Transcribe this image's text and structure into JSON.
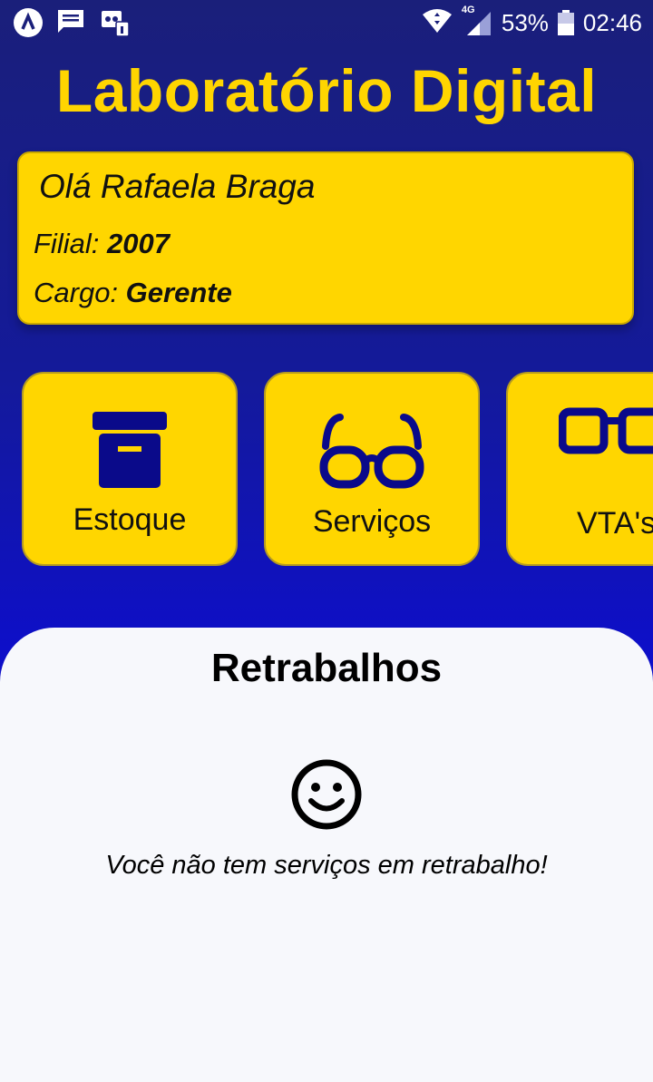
{
  "status_bar": {
    "battery_percent": "53%",
    "time": "02:46",
    "network": "4G",
    "icons": [
      "app-icon",
      "message-icon",
      "notification-icon",
      "wifi-icon",
      "signal-icon",
      "battery-icon"
    ]
  },
  "header": {
    "title": "Laboratório Digital"
  },
  "user_card": {
    "greeting": "Olá Rafaela Braga",
    "branch_label": "Filial:",
    "branch_value": "2007",
    "role_label": "Cargo:",
    "role_value": "Gerente"
  },
  "tiles": [
    {
      "label": "Estoque",
      "icon": "box-icon"
    },
    {
      "label": "Serviços",
      "icon": "glasses-icon"
    },
    {
      "label": "VTA's",
      "icon": "glasses-icon"
    }
  ],
  "panel": {
    "title": "Retrabalhos",
    "empty_message": "Você não tem serviços em retrabalho!",
    "empty_icon": "smiley-icon"
  },
  "colors": {
    "accent_yellow": "#ffd600",
    "title_yellow": "#ffd500",
    "icon_navy": "#0a0a8a",
    "background_blue": "#141a9a",
    "panel_bg": "#f7f8fc"
  }
}
